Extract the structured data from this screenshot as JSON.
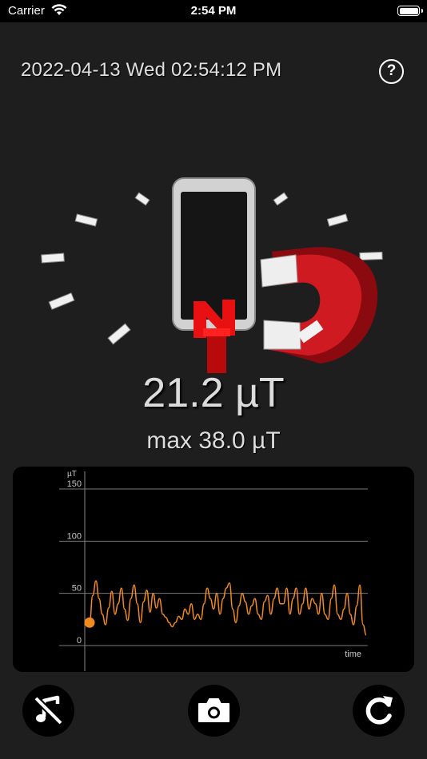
{
  "status_bar": {
    "carrier": "Carrier",
    "time": "2:54 PM"
  },
  "header": {
    "datetime": "2022-04-13 Wed 02:54:12 PM",
    "help_label": "?"
  },
  "illustration": {
    "icon": "phone-magnet-icon"
  },
  "reading": {
    "current": "21.2 µT",
    "max": "max 38.0 µT"
  },
  "chart_data": {
    "type": "line",
    "ylabel": "µT",
    "xlabel": "time",
    "ylim": [
      0,
      150
    ],
    "yticks": [
      "150",
      "100",
      "50",
      "0"
    ],
    "series": [
      {
        "color": "#f28a1e",
        "values": [
          22,
          48,
          62,
          45,
          30,
          20,
          36,
          52,
          30,
          40,
          55,
          35,
          24,
          45,
          58,
          40,
          22,
          42,
          53,
          32,
          50,
          36,
          45,
          30,
          27,
          22,
          18,
          22,
          28,
          25,
          35,
          30,
          40,
          25,
          30,
          25,
          40,
          55,
          45,
          35,
          50,
          30,
          45,
          55,
          60,
          35,
          22,
          38,
          50,
          42,
          30,
          38,
          45,
          30,
          25,
          42,
          48,
          30,
          45,
          55,
          40,
          40,
          55,
          30,
          45,
          55,
          30,
          40,
          55,
          35,
          45,
          40,
          30,
          50,
          30,
          25,
          45,
          58,
          30,
          25,
          35,
          50,
          30,
          20,
          38,
          58,
          20,
          10
        ],
        "current_value": 22
      }
    ]
  },
  "toolbar": {
    "sound_icon": "muted-music-icon",
    "camera_icon": "camera-icon",
    "reset_icon": "refresh-icon"
  },
  "colors": {
    "background": "#1e1e1e",
    "chart_line": "#f28a1e",
    "magnet_red": "#c8141c"
  }
}
